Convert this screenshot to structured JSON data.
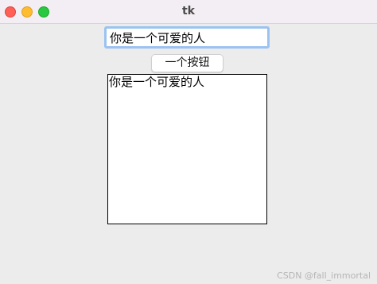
{
  "window": {
    "title": "tk"
  },
  "entry": {
    "value": "你是一个可爱的人"
  },
  "button": {
    "label": "一个按钮"
  },
  "textbox": {
    "content": "你是一个可爱的人"
  },
  "watermark": {
    "text": "CSDN @fall_immortal"
  },
  "colors": {
    "close": "#fe5f57",
    "minimize": "#febc2e",
    "maximize": "#28c840",
    "focus_ring": "#9cc3f0",
    "background": "#ececec"
  }
}
